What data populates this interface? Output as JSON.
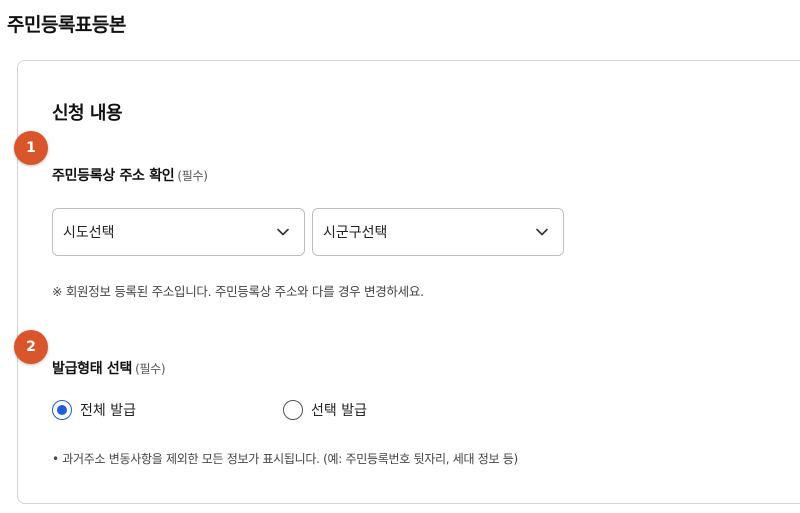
{
  "page": {
    "title": "주민등록표등본"
  },
  "section": {
    "title": "신청 내용"
  },
  "steps": {
    "step1": "1",
    "step2": "2"
  },
  "address": {
    "label": "주민등록상 주소 확인",
    "required": "(필수)",
    "sido_select": {
      "value": "시도선택"
    },
    "sigungu_select": {
      "value": "시군구선택"
    },
    "notice": "※ 회원정보 등록된 주소입니다. 주민등록상 주소와 다를 경우 변경하세요."
  },
  "issue_type": {
    "label": "발급형태 선택",
    "required": "(필수)",
    "options": [
      {
        "label": "전체 발급",
        "selected": true
      },
      {
        "label": "선택 발급",
        "selected": false
      }
    ],
    "note": "• 과거주소 변동사항을 제외한 모든 정보가 표시됩니다. (예: 주민등록번호 뒷자리, 세대 정보 등)"
  },
  "colors": {
    "step_badge": "#d9552b",
    "radio_selected": "#1f5fd6",
    "border": "#bdbdbd"
  },
  "icons": {
    "dropdown": "chevron-down-icon"
  }
}
